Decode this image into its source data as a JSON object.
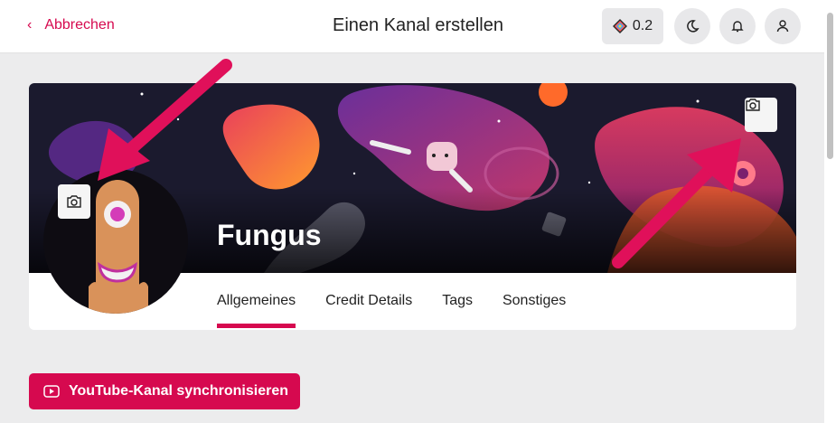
{
  "header": {
    "back_label": "Abbrechen",
    "title": "Einen Kanal erstellen",
    "credits_value": "0.2",
    "icons": {
      "back": "chevron-left-icon",
      "credits": "lbc-credit-icon",
      "theme": "moon-icon",
      "notifications": "bell-icon",
      "account": "user-icon"
    }
  },
  "channel": {
    "name": "Fungus",
    "banner_camera_icon": "camera-icon",
    "avatar_camera_icon": "camera-icon"
  },
  "tabs": [
    {
      "label": "Allgemeines",
      "active": true
    },
    {
      "label": "Credit Details",
      "active": false
    },
    {
      "label": "Tags",
      "active": false
    },
    {
      "label": "Sonstiges",
      "active": false
    }
  ],
  "actions": {
    "youtube_sync_label": "YouTube-Kanal synchronisieren",
    "youtube_icon": "youtube-icon"
  },
  "colors": {
    "accent": "#d6094f",
    "banner_bg": "#1b1a2e",
    "page_bg": "#ececed"
  }
}
